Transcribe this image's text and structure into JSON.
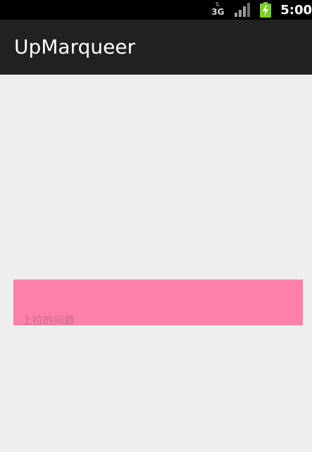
{
  "status_bar": {
    "network_type": "3G",
    "network_arrows": "⇅",
    "icons": [
      "signal-strength-icon",
      "battery-charging-icon"
    ],
    "time": "5:00"
  },
  "action_bar": {
    "title": "UpMarqueer"
  },
  "marquee": {
    "text": "上拉的问题",
    "background": "#ff80a8"
  },
  "colors": {
    "status_bar": "#000000",
    "action_bar": "#212121",
    "content_bg": "#eeeeee",
    "battery": "#7ccf2a"
  }
}
